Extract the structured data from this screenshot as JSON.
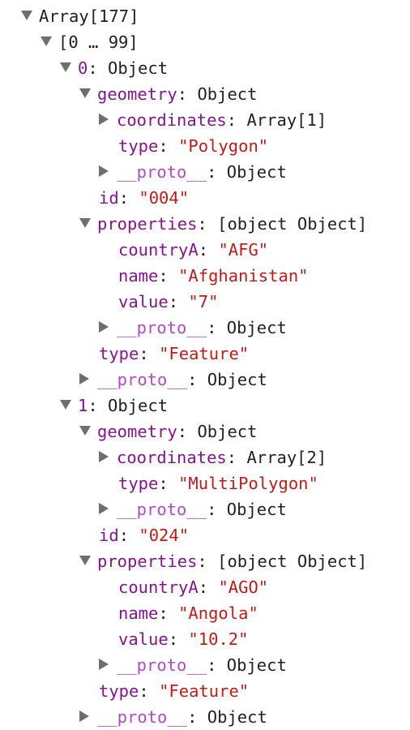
{
  "tree": {
    "root": {
      "label": "Array[177]"
    },
    "range": {
      "label": "[0 … 99]"
    },
    "items": [
      {
        "index": "0",
        "type_label": "Object",
        "geometry": {
          "key": "geometry",
          "value": "Object",
          "coordinates": {
            "key": "coordinates",
            "value": "Array[1]"
          },
          "type": {
            "key": "type",
            "value": "\"Polygon\""
          },
          "proto": {
            "key": "__proto__",
            "value": "Object"
          }
        },
        "id": {
          "key": "id",
          "value": "\"004\""
        },
        "properties": {
          "key": "properties",
          "value": {
            "key": "value",
            "value": "\"7\""
          },
          "countryA": {
            "key": "countryA",
            "value": "\"AFG\""
          },
          "name": {
            "key": "name",
            "value": "\"Afghanistan\""
          },
          "proto": {
            "key": "__proto__",
            "value": "Object"
          }
        },
        "type": {
          "key": "type",
          "value": "\"Feature\""
        },
        "proto": {
          "key": "__proto__",
          "value": "Object"
        }
      },
      {
        "index": "1",
        "type_label": "Object",
        "geometry": {
          "key": "geometry",
          "value": "Object",
          "coordinates": {
            "key": "coordinates",
            "value": "Array[2]"
          },
          "type": {
            "key": "type",
            "value": "\"MultiPolygon\""
          },
          "proto": {
            "key": "__proto__",
            "value": "Object"
          }
        },
        "id": {
          "key": "id",
          "value": "\"024\""
        },
        "properties": {
          "key": "properties",
          "value": {
            "key": "value",
            "value": "\"10.2\""
          },
          "countryA": {
            "key": "countryA",
            "value": "\"AGO\""
          },
          "name": {
            "key": "name",
            "value": "\"Angola\""
          },
          "proto": {
            "key": "__proto__",
            "value": "Object"
          }
        },
        "type": {
          "key": "type",
          "value": "\"Feature\""
        },
        "proto": {
          "key": "__proto__",
          "value": "Object"
        }
      }
    ]
  }
}
